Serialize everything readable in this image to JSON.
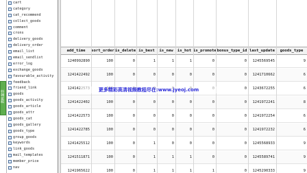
{
  "side_tab": {
    "label": "资料显示"
  },
  "tree": {
    "items": [
      "cart",
      "category",
      "cat_recommend",
      "collect_goods",
      "comment",
      "crons",
      "delivery_goods",
      "delivery_order",
      "email_list",
      "email_sendlist",
      "error_log",
      "exchange_goods",
      "favourable_activity",
      "feedback",
      "friend_link",
      "goods",
      "goods_activity",
      "goods_article",
      "goods_attr",
      "goods_cat",
      "goods_gallery",
      "goods_type",
      "group_goods",
      "keywords",
      "link_goods",
      "mail_templates",
      "member_price",
      "nav"
    ]
  },
  "table": {
    "columns": [
      "add_time",
      "sort_order",
      "is_delete",
      "is_best",
      "is_new",
      "is_hot",
      "is_promote",
      "bonus_type_id",
      "last_update",
      "goods_type"
    ],
    "rows": [
      [
        "1240992890",
        "100",
        "0",
        "1",
        "1",
        "1",
        "0",
        "0",
        "1245569545",
        "9"
      ],
      [
        "1241422492",
        "100",
        "0",
        "0",
        "0",
        "0",
        "0",
        "0",
        "1241710662",
        "6"
      ],
      [
        "1241422573",
        "100",
        "0",
        "0",
        "0",
        "0",
        "0",
        "0",
        "1243672255",
        "6"
      ],
      [
        "1241422402",
        "100",
        "0",
        "0",
        "0",
        "0",
        "0",
        "0",
        "1241972241",
        "8"
      ],
      [
        "1241422573",
        "100",
        "0",
        "0",
        "0",
        "0",
        "0",
        "0",
        "1241972254",
        "6"
      ],
      [
        "1241422785",
        "100",
        "0",
        "0",
        "0",
        "0",
        "0",
        "0",
        "1241972232",
        "6"
      ],
      [
        "1241425512",
        "100",
        "0",
        "1",
        "0",
        "0",
        "0",
        "0",
        "1245568933",
        "9"
      ],
      [
        "1241511871",
        "100",
        "0",
        "1",
        "1",
        "1",
        "0",
        "0",
        "1245589741",
        "9"
      ],
      [
        "1241965622",
        "100",
        "0",
        "1",
        "1",
        "1",
        "1",
        "0",
        "1245290333",
        "9"
      ]
    ]
  },
  "watermark": {
    "text": "更多精彩高清视频教程尽在:www.jyeoj.com"
  }
}
